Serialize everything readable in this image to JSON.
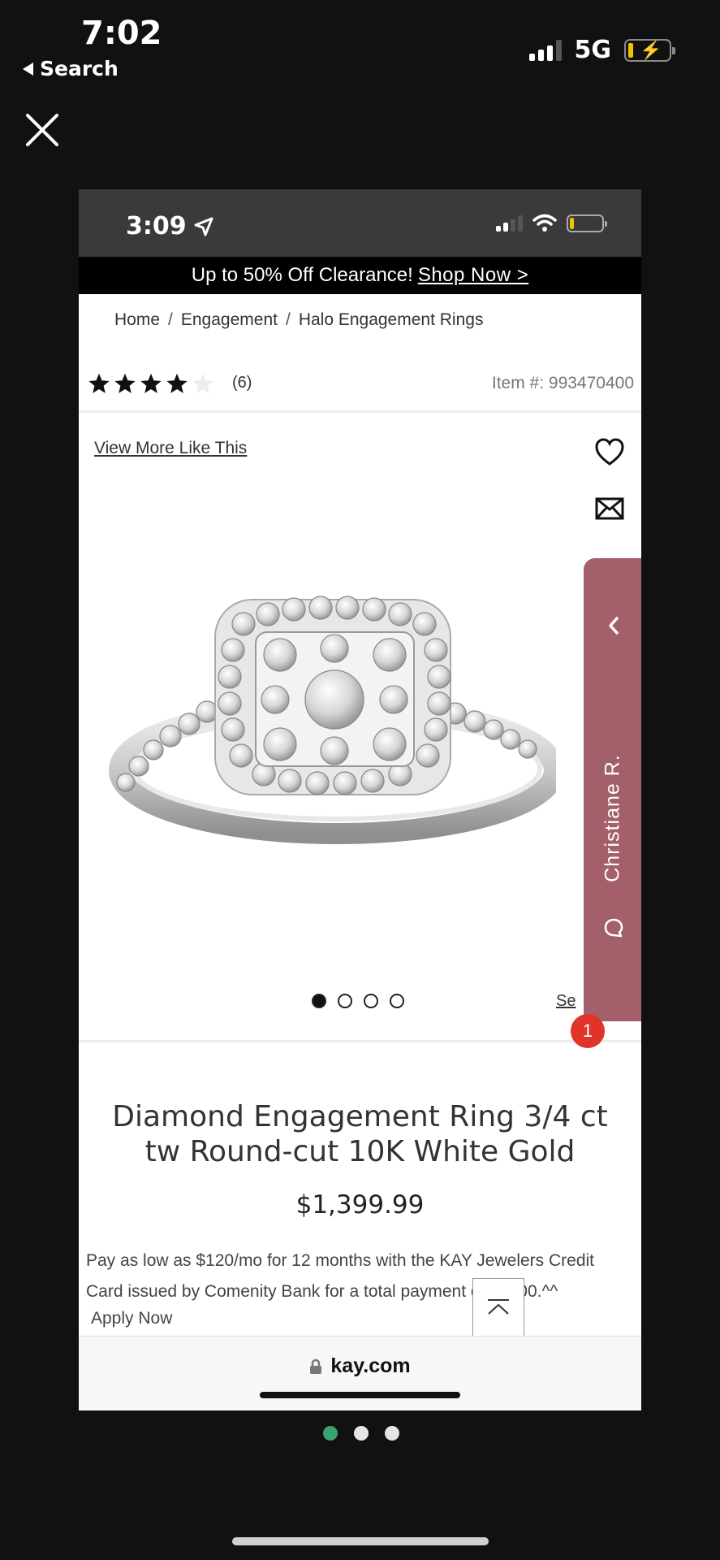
{
  "outer": {
    "time": "7:02",
    "back_label": "Search",
    "network": "5G"
  },
  "inner_status": {
    "time": "3:09"
  },
  "promo": {
    "text": "Up to 50% Off Clearance!",
    "link": "Shop Now >"
  },
  "breadcrumb": {
    "items": [
      "Home",
      "Engagement",
      "Halo Engagement Rings"
    ],
    "separator": "/"
  },
  "rating": {
    "stars": 4,
    "max": 5,
    "count_label": "(6)"
  },
  "item_number": "Item #: 993470400",
  "gallery": {
    "view_more": "View More Like This",
    "see_label": "Se",
    "active_dot": 1,
    "dot_count": 4
  },
  "chat": {
    "agent_name": "Christiane R.",
    "badge": "1"
  },
  "product": {
    "title": "Diamond Engagement Ring 3/4 ct tw Round-cut 10K White Gold",
    "price": "$1,399.99",
    "finance_text": "Pay as low as $120/mo for 12 months with the KAY Jewelers Credit Card issued by Comenity Bank for a total payment of $1400.^^",
    "apply_label": "Apply Now"
  },
  "browser": {
    "url": "kay.com"
  },
  "colors": {
    "chat_tab": "#a35f6a",
    "badge": "#e0342b",
    "active_page_dot": "#3aa271",
    "battery_level": "#f2c200"
  }
}
